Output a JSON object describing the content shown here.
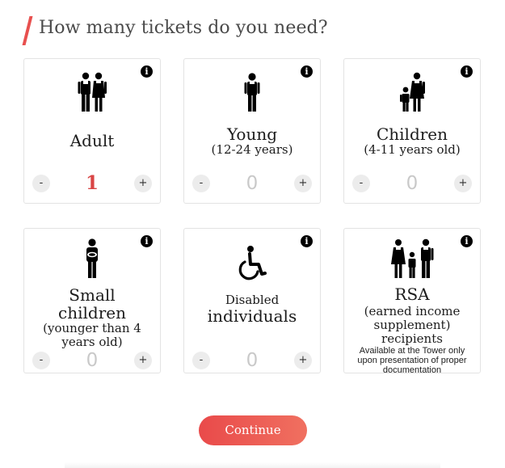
{
  "page": {
    "title": "How many tickets do you need?",
    "continue_label": "Continue",
    "accent_color": "#e8504f"
  },
  "info_glyph": "i",
  "minus_glyph": "-",
  "plus_glyph": "+",
  "cards": [
    {
      "id": "adult",
      "icon": "couple-icon",
      "label": "Adult",
      "sub": "",
      "count": "1",
      "active": true
    },
    {
      "id": "young",
      "icon": "young-person-icon",
      "label": "Young",
      "sub": "(12-24 years)",
      "count": "0",
      "active": false
    },
    {
      "id": "children",
      "icon": "parent-child-icon",
      "label": "Children",
      "sub": "(4-11 years old)",
      "count": "0",
      "active": false
    },
    {
      "id": "small-children",
      "icon": "adult-holding-baby-icon",
      "label_line1": "Small",
      "label_line2": "children",
      "sub_line1": "(younger than 4",
      "sub_line2": "years old)",
      "count": "0",
      "active": false
    },
    {
      "id": "disabled",
      "icon": "wheelchair-icon",
      "label_line1": "Disabled",
      "label_line2": "individuals",
      "count": "0",
      "active": false
    },
    {
      "id": "rsa",
      "icon": "family-icon",
      "label": "RSA",
      "sub_line1": "(earned income",
      "sub_line2": "supplement)",
      "sub_line3": "recipients",
      "note_line1": "Available at the Tower only",
      "note_line2": "upon presentation of proper",
      "note_line3": "documentation",
      "count": "",
      "active": false
    }
  ]
}
